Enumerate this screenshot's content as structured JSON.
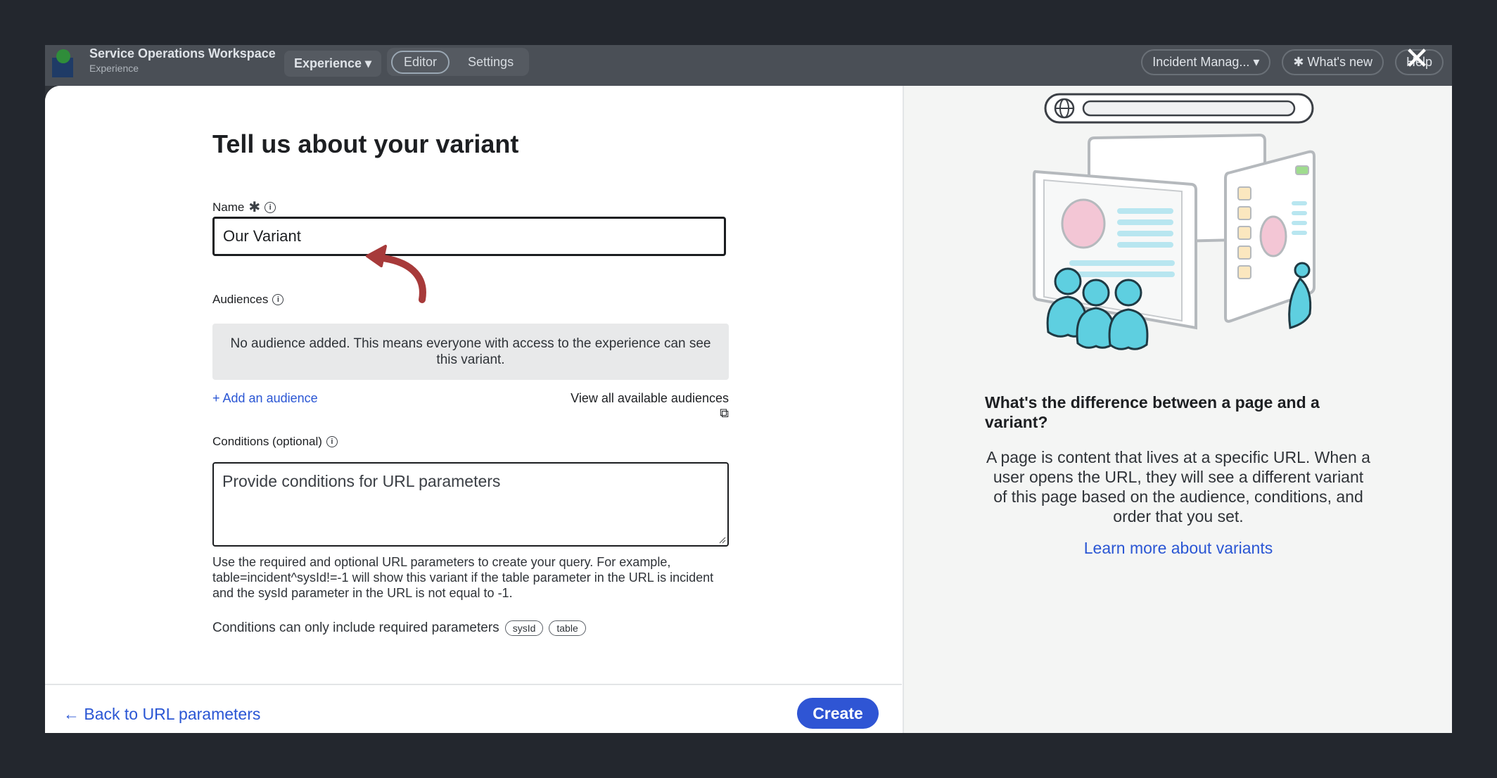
{
  "app": {
    "title": "Service Operations Workspace",
    "subtitle": "Experience",
    "experience_menu": "Experience ▾",
    "tabs": [
      {
        "label": "Editor",
        "active": true
      },
      {
        "label": "Settings",
        "active": false
      }
    ],
    "incident_dropdown": "Incident Manag... ▾",
    "whats_new": "✱ What's new",
    "help": "Help"
  },
  "modal": {
    "title": "Tell us about your variant",
    "name": {
      "label": "Name",
      "value": "Our Variant"
    },
    "audiences": {
      "label": "Audiences",
      "empty_message": "No audience added. This means everyone with access to the experience can see this variant.",
      "add_link": "+ Add an audience",
      "view_all_link": "View all available audiences"
    },
    "conditions": {
      "label": "Conditions (optional)",
      "placeholder": "Provide conditions for URL parameters",
      "help": "Use the required and optional URL parameters to create your query. For example, table=incident^sysId!=-1 will show this variant if the table parameter in the URL is incident and the sysId parameter in the URL is not equal to -1.",
      "required_params_label": "Conditions can only include required parameters",
      "required_params": [
        "sysId",
        "table"
      ]
    },
    "footer": {
      "back_label": "← Back to URL parameters",
      "create_label": "Create"
    },
    "side": {
      "heading": "What's the difference between a page and a variant?",
      "body": "A page is content that lives at a specific URL. When a user opens the URL, they will see a different variant of this page based on the audience, conditions, and order that you set.",
      "link": "Learn more about variants"
    }
  },
  "colors": {
    "accent": "#2f55d4",
    "link": "#2a56d4",
    "annotation_arrow": "#a73a3a",
    "illustration_teal": "#5ecfe0",
    "illustration_pink": "#f3c6d5"
  }
}
